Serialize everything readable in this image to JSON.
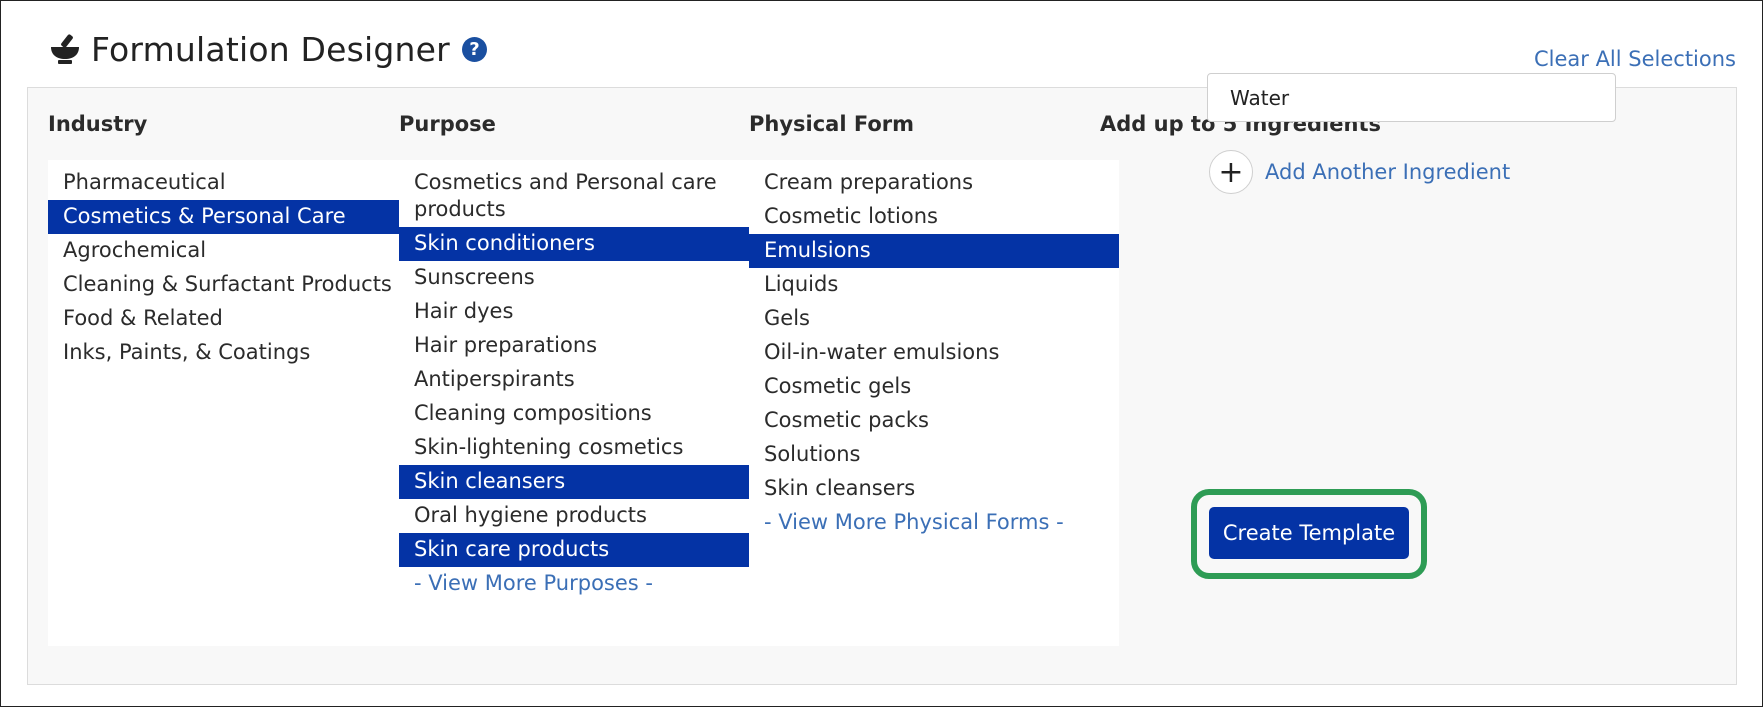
{
  "header": {
    "title": "Formulation Designer",
    "help_icon": "question-circle-icon",
    "help_glyph": "?",
    "clear_all": "Clear All Selections",
    "logo_icon": "mortar-pestle-icon"
  },
  "colors": {
    "selected_bg": "#0433a5",
    "link": "#3b6fb6",
    "highlight_border": "#2e9c55"
  },
  "industry": {
    "heading": "Industry",
    "items": [
      {
        "label": "Pharmaceutical",
        "selected": false
      },
      {
        "label": "Cosmetics & Personal Care",
        "selected": true
      },
      {
        "label": "Agrochemical",
        "selected": false
      },
      {
        "label": "Cleaning & Surfactant Products",
        "selected": false
      },
      {
        "label": "Food & Related",
        "selected": false
      },
      {
        "label": "Inks, Paints, & Coatings",
        "selected": false
      }
    ]
  },
  "purpose": {
    "heading": "Purpose",
    "items": [
      {
        "label": "Cosmetics and Personal care products",
        "selected": false
      },
      {
        "label": "Skin conditioners",
        "selected": true
      },
      {
        "label": "Sunscreens",
        "selected": false
      },
      {
        "label": "Hair dyes",
        "selected": false
      },
      {
        "label": "Hair preparations",
        "selected": false
      },
      {
        "label": "Antiperspirants",
        "selected": false
      },
      {
        "label": "Cleaning compositions",
        "selected": false
      },
      {
        "label": "Skin-lightening cosmetics",
        "selected": false
      },
      {
        "label": "Skin cleansers",
        "selected": true
      },
      {
        "label": "Oral hygiene products",
        "selected": false
      },
      {
        "label": "Skin care products",
        "selected": true
      }
    ],
    "view_more": "- View More Purposes -"
  },
  "physical_form": {
    "heading": "Physical Form",
    "items": [
      {
        "label": "Cream preparations",
        "selected": false
      },
      {
        "label": "Cosmetic lotions",
        "selected": false
      },
      {
        "label": "Emulsions",
        "selected": true
      },
      {
        "label": "Liquids",
        "selected": false
      },
      {
        "label": "Gels",
        "selected": false
      },
      {
        "label": "Oil-in-water emulsions",
        "selected": false
      },
      {
        "label": "Cosmetic gels",
        "selected": false
      },
      {
        "label": "Cosmetic packs",
        "selected": false
      },
      {
        "label": "Solutions",
        "selected": false
      },
      {
        "label": "Skin cleansers",
        "selected": false
      }
    ],
    "view_more": "- View More Physical Forms -"
  },
  "ingredients": {
    "heading": "Add up to 5 Ingredients",
    "input_value": "Water",
    "add_icon": "plus-circle-icon",
    "add_glyph": "+",
    "add_label": "Add Another Ingredient"
  },
  "actions": {
    "create_template": "Create Template"
  }
}
